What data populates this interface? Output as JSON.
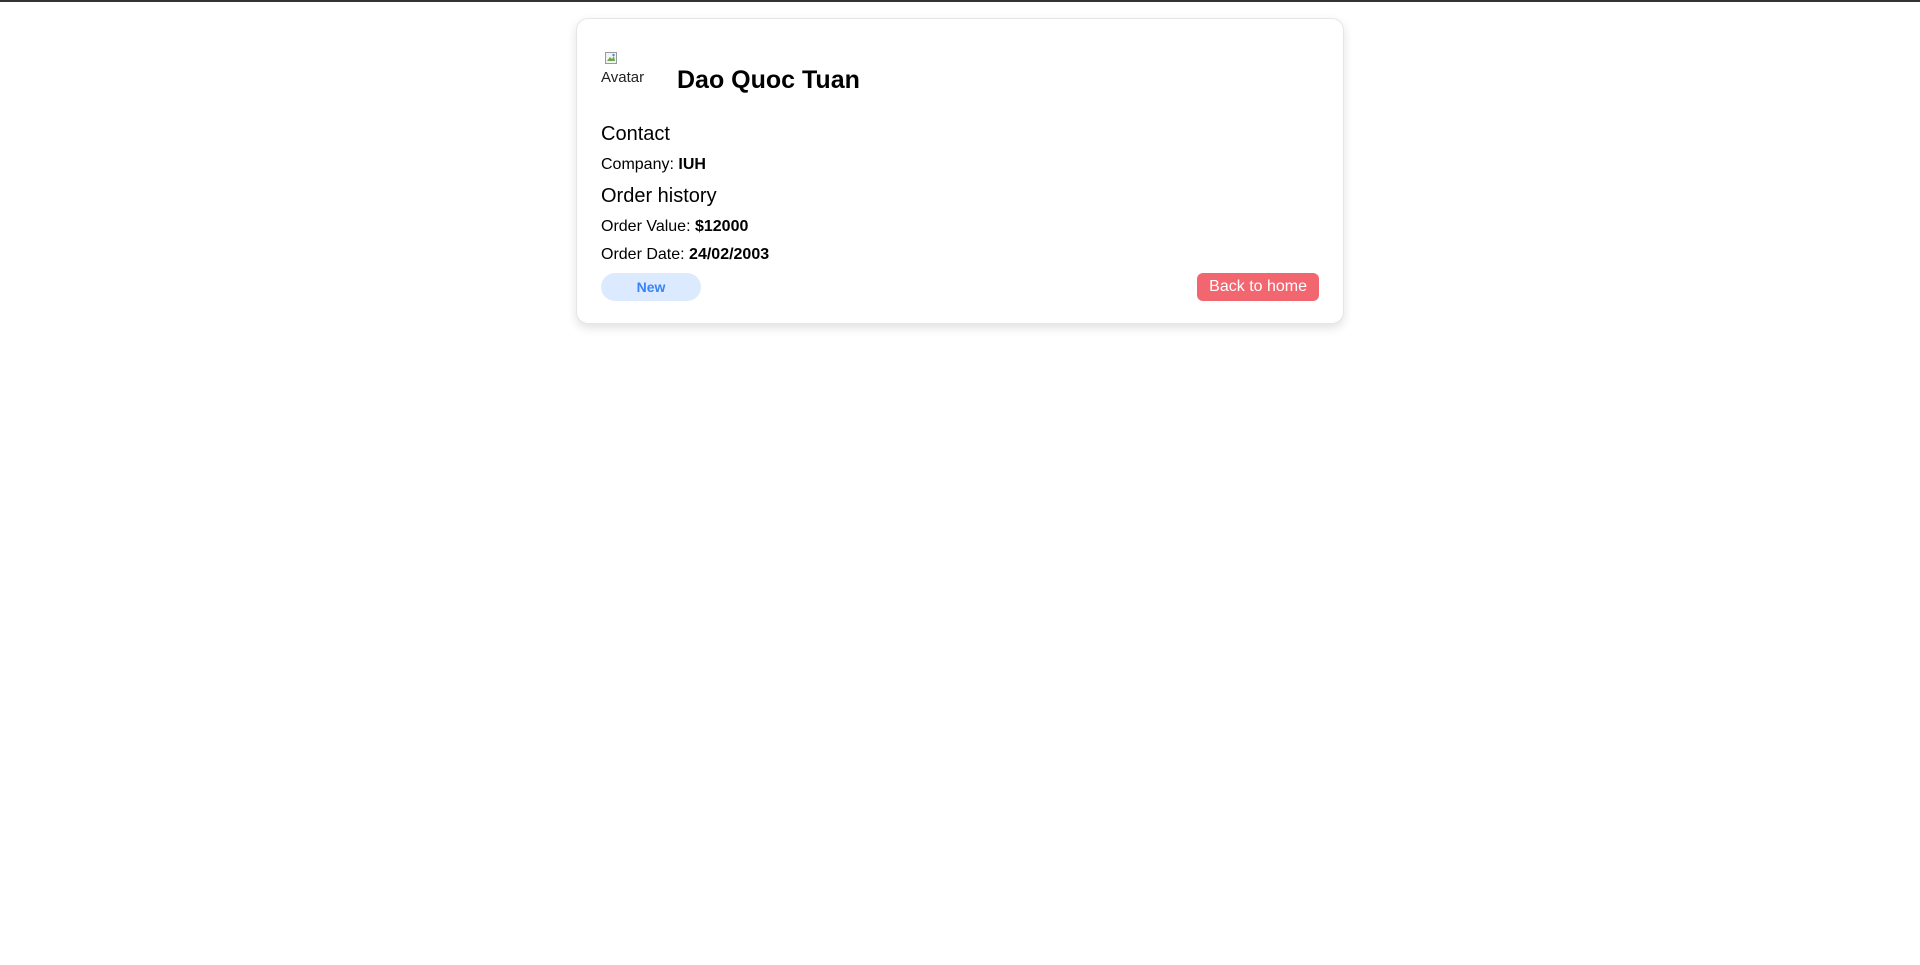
{
  "profile": {
    "avatar_alt": "Avatar",
    "name": "Dao Quoc Tuan"
  },
  "contact": {
    "title": "Contact",
    "company_label": "Company:",
    "company_value": "IUH"
  },
  "orders": {
    "title": "Order history",
    "value_label": "Order Value:",
    "value": "$12000",
    "date_label": "Order Date:",
    "date": "24/02/2003"
  },
  "footer": {
    "badge": "New",
    "back_label": "Back to home"
  },
  "colors": {
    "badge_bg": "#dbeafe",
    "badge_text": "#3b82f6",
    "back_button": "#f26670"
  }
}
